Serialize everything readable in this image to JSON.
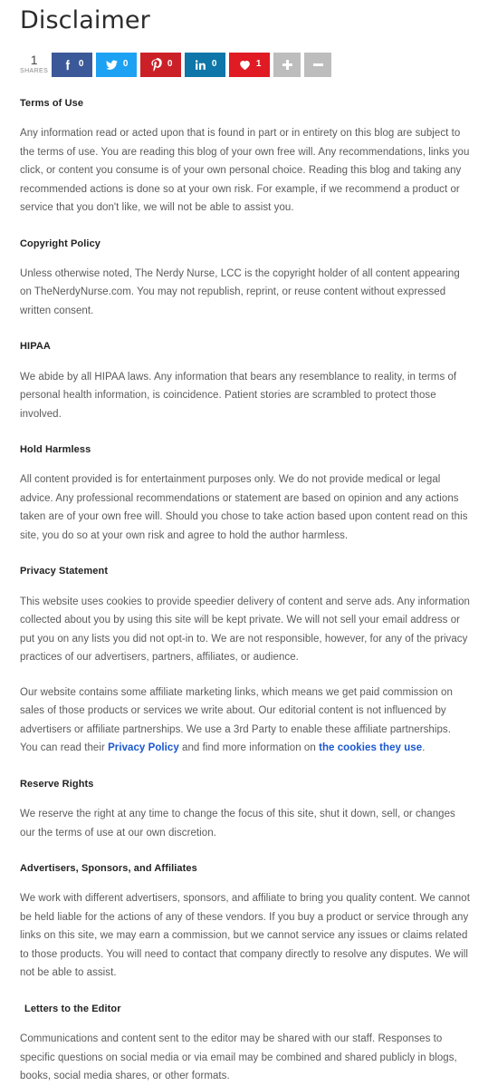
{
  "page": {
    "title": "Disclaimer"
  },
  "share_bar": {
    "total_count": "1",
    "total_label": "SHARES",
    "buttons": [
      {
        "network": "facebook",
        "icon": "facebook-icon",
        "count": "0",
        "color": "#3b5998"
      },
      {
        "network": "twitter",
        "icon": "twitter-icon",
        "count": "0",
        "color": "#1da1f2"
      },
      {
        "network": "pinterest",
        "icon": "pinterest-icon",
        "count": "0",
        "color": "#cb2027"
      },
      {
        "network": "linkedin",
        "icon": "linkedin-icon",
        "count": "0",
        "color": "#0e76a8"
      },
      {
        "network": "love",
        "icon": "heart-icon",
        "count": "1",
        "color": "#e01b24"
      }
    ],
    "more_button": {
      "icon": "plus-icon",
      "color": "#bdbdbd"
    },
    "less_button": {
      "icon": "minus-icon",
      "color": "#bdbdbd"
    }
  },
  "sections": [
    {
      "heading": "Terms of Use",
      "paragraphs": [
        "Any information read or acted upon that is found in part or in entirety on this blog are subject to the terms of use. You are reading this blog of your own free will. Any recommendations, links you click, or content you consume is of your own personal choice. Reading this blog and taking any recommended actions is done so at your own risk. For example, if we recommend a product or service that you don't like, we will not be able to assist you."
      ]
    },
    {
      "heading": "Copyright Policy",
      "paragraphs": [
        "Unless otherwise noted, The Nerdy Nurse, LCC is the copyright holder of all content appearing on TheNerdyNurse.com. You may not republish, reprint, or reuse content without expressed written consent."
      ]
    },
    {
      "heading": "HIPAA",
      "paragraphs": [
        "We abide by all HIPAA laws. Any information that bears any resemblance to reality, in terms of personal health information, is coincidence. Patient stories are scrambled to protect those involved."
      ]
    },
    {
      "heading": "Hold Harmless",
      "paragraphs": [
        "All content provided is for entertainment purposes only. We do not provide medical or legal advice. Any professional recommendations or statement are based on opinion and any actions taken are of your own free will. Should you chose to take action based upon content read on this site, you do so at your own risk and agree to hold the author harmless."
      ]
    },
    {
      "heading": "Privacy Statement",
      "paragraphs": [
        "This website uses cookies to provide speedier delivery of content and serve ads. Any information collected about you by using this site will be kept private. We will not sell your email address or put you on any lists you did not opt-in to. We are not responsible, however, for any of the privacy practices of our advertisers, partners, affiliates, or audience."
      ],
      "rich_paragraph": {
        "before_link_1": "Our website contains some affiliate marketing links, which means we get paid commission on sales of those products or services we write about. Our editorial content is not influenced by advertisers or affiliate partnerships. We use a 3rd Party to enable these affiliate partnerships. You can read their ",
        "link_1": "Privacy Policy",
        "between_links": " and find more information on ",
        "link_2": "the cookies they use",
        "after_link_2": "."
      }
    },
    {
      "heading": "Reserve Rights",
      "paragraphs": [
        "We reserve the right at any time to change the focus of this site, shut it down, sell, or changes our the terms of use at our own discretion."
      ]
    },
    {
      "heading": "Advertisers, Sponsors, and Affiliates",
      "paragraphs": [
        "We work with different advertisers, sponsors, and affiliate to bring you quality content. We cannot be held liable for the actions of any of these vendors. If you buy a product or service through any links on this site, we may earn a commission, but we cannot service any issues or claims related to those products. You will need to contact that company directly to resolve any disputes. We will not be able to assist."
      ]
    },
    {
      "heading": "Letters to the Editor",
      "indented": true,
      "paragraphs": [
        "Communications and content sent to the editor may be shared with our staff. Responses to specific questions on social media or via email may be combined and shared publicly in blogs, books, social media shares, or other formats."
      ]
    }
  ],
  "colors": {
    "link": "#1a57cf",
    "heading": "#222222",
    "body": "#5a5a5a",
    "title": "#2b2b2b"
  }
}
